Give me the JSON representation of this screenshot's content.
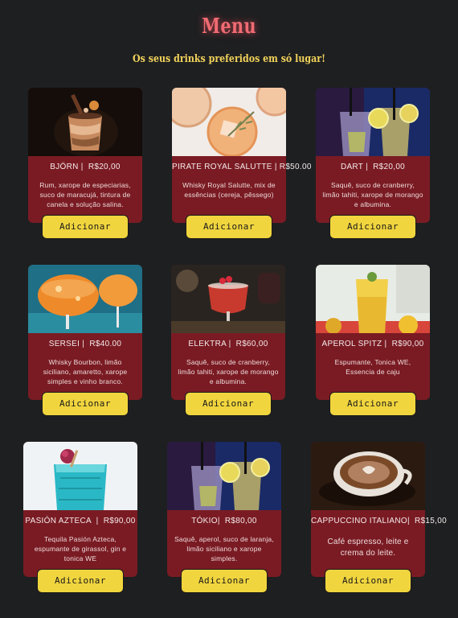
{
  "header": {
    "title": "Menu",
    "subtitle": "Os seus drinks preferidos em só lugar!"
  },
  "colors": {
    "background": "#1e1f21",
    "card": "#7a1b23",
    "button": "#f1d53e",
    "title": "#f06b73",
    "subtitle": "#f2d35b"
  },
  "items": [
    {
      "name": "BJÖRN",
      "price": "R$20,00",
      "description": "Rum, xarope de especiarias, suco de maracujá, tintura de canela e solução salina.",
      "button": "Adicionar"
    },
    {
      "name": "PIRATE ROYAL SALUTTE",
      "price": "R$50.00",
      "description": "Whisky Royal Salutte, mix de essências (cereja, pêssego)",
      "button": "Adicionar"
    },
    {
      "name": "DART",
      "price": "R$20,00",
      "description": "Saquê, suco de cranberry, limão tahiti, xarope de morango e albumina.",
      "button": "Adicionar"
    },
    {
      "name": "SERSEI",
      "price": "R$40.00",
      "description": "Whisky Bourbon, limão siciliano, amaretto, xarope simples e vinho branco.",
      "button": "Adicionar"
    },
    {
      "name": "ELEKTRA",
      "price": "R$60,00",
      "description": "Saquê, suco de cranberry, limão tahiti, xarope de morango e albumina.",
      "button": "Adicionar"
    },
    {
      "name": "APEROL SPITZ",
      "price": "R$90,00",
      "description": "Espumante, Tonica WE, Essencia de caju",
      "button": "Adicionar"
    },
    {
      "name": "PASIÓN AZTECA",
      "price": "R$90,00",
      "description": "Tequila Pasión Azteca, espumante de girassol, gin e tonica WE",
      "button": "Adicionar"
    },
    {
      "name": "TÓKIO",
      "price": "R$80,00",
      "description": "Saquê, aperol, suco de laranja, limão siciliano e xarope simples.",
      "button": "Adicionar"
    },
    {
      "name": "CAPPUCCINO ITALIANO",
      "price": "R$15,00",
      "description": "Café espresso, leite e crema do leite.",
      "button": "Adicionar"
    }
  ]
}
